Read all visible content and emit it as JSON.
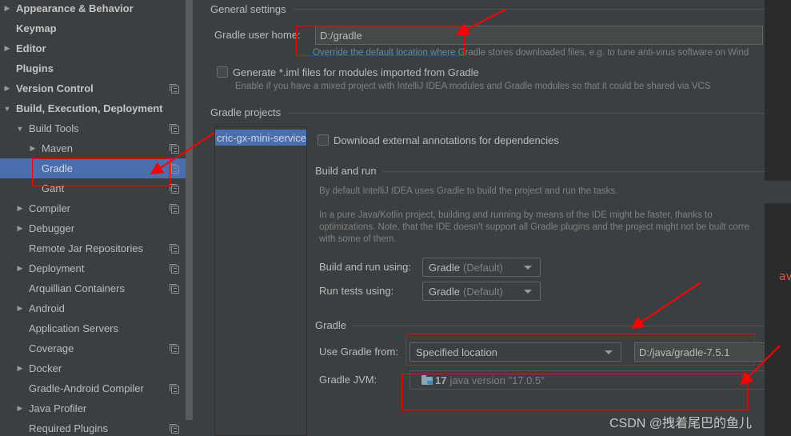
{
  "sidebar": {
    "items": [
      {
        "label": "Appearance & Behavior",
        "arrow": "▶",
        "bold": true
      },
      {
        "label": "Keymap",
        "arrow": "",
        "bold": true
      },
      {
        "label": "Editor",
        "arrow": "▶",
        "bold": true
      },
      {
        "label": "Plugins",
        "arrow": "",
        "bold": true
      },
      {
        "label": "Version Control",
        "arrow": "▶",
        "bold": true
      },
      {
        "label": "Build, Execution, Deployment",
        "arrow": "▼",
        "bold": true
      },
      {
        "label": "Build Tools",
        "arrow": "▼"
      },
      {
        "label": "Maven",
        "arrow": "▶"
      },
      {
        "label": "Gradle",
        "arrow": "",
        "selected": true
      },
      {
        "label": "Gant",
        "arrow": ""
      },
      {
        "label": "Compiler",
        "arrow": "▶"
      },
      {
        "label": "Debugger",
        "arrow": "▶"
      },
      {
        "label": "Remote Jar Repositories",
        "arrow": ""
      },
      {
        "label": "Deployment",
        "arrow": "▶"
      },
      {
        "label": "Arquillian Containers",
        "arrow": ""
      },
      {
        "label": "Android",
        "arrow": "▶"
      },
      {
        "label": "Application Servers",
        "arrow": ""
      },
      {
        "label": "Coverage",
        "arrow": ""
      },
      {
        "label": "Docker",
        "arrow": "▶"
      },
      {
        "label": "Gradle-Android Compiler",
        "arrow": ""
      },
      {
        "label": "Java Profiler",
        "arrow": "▶"
      },
      {
        "label": "Required Plugins",
        "arrow": ""
      }
    ]
  },
  "general": {
    "title": "General settings",
    "user_home_label": "Gradle user home:",
    "user_home_value": "D:/gradle",
    "user_home_hint": "Override the default location where Gradle stores downloaded files, e.g. to tune anti-virus software on Wind",
    "generate_iml_label": "Generate *.iml files for modules imported from Gradle",
    "generate_iml_checked": false,
    "generate_iml_hint": "Enable if you have a mixed project with IntelliJ IDEA modules and Gradle modules so that it could be shared via VCS"
  },
  "projects": {
    "title": "Gradle projects",
    "list": [
      "cric-gx-mini-service"
    ],
    "download_annotations_label": "Download external annotations for dependencies",
    "download_annotations_checked": false
  },
  "build_run": {
    "title": "Build and run",
    "hint1": "By default IntelliJ IDEA uses Gradle to build the project and run the tasks.",
    "hint2_line1": "In a pure Java/Kotlin project, building and running by means of the IDE might be faster, thanks to",
    "hint2_line2": "optimizations. Note, that the IDE doesn't support all Gradle plugins and the project might not be built corre",
    "hint2_line3": "with some of them.",
    "build_using_label": "Build and run using:",
    "build_using_value": "Gradle",
    "build_using_suffix": "(Default)",
    "tests_using_label": "Run tests using:",
    "tests_using_value": "Gradle",
    "tests_using_suffix": "(Default)"
  },
  "gradle": {
    "title": "Gradle",
    "use_from_label": "Use Gradle from:",
    "use_from_value": "Specified location",
    "location_value": "D:/java/gradle-7.5.1",
    "jvm_label": "Gradle JVM:",
    "jvm_version": "17",
    "jvm_detail": "java version \"17.0.5\""
  },
  "background": {
    "code_snippet": "av"
  },
  "watermark": "CSDN @拽着尾巴的鱼儿",
  "colors": {
    "selection": "#4b6eaf",
    "annotation_red": "#ff0000",
    "panel_bg": "#3c3f41"
  }
}
